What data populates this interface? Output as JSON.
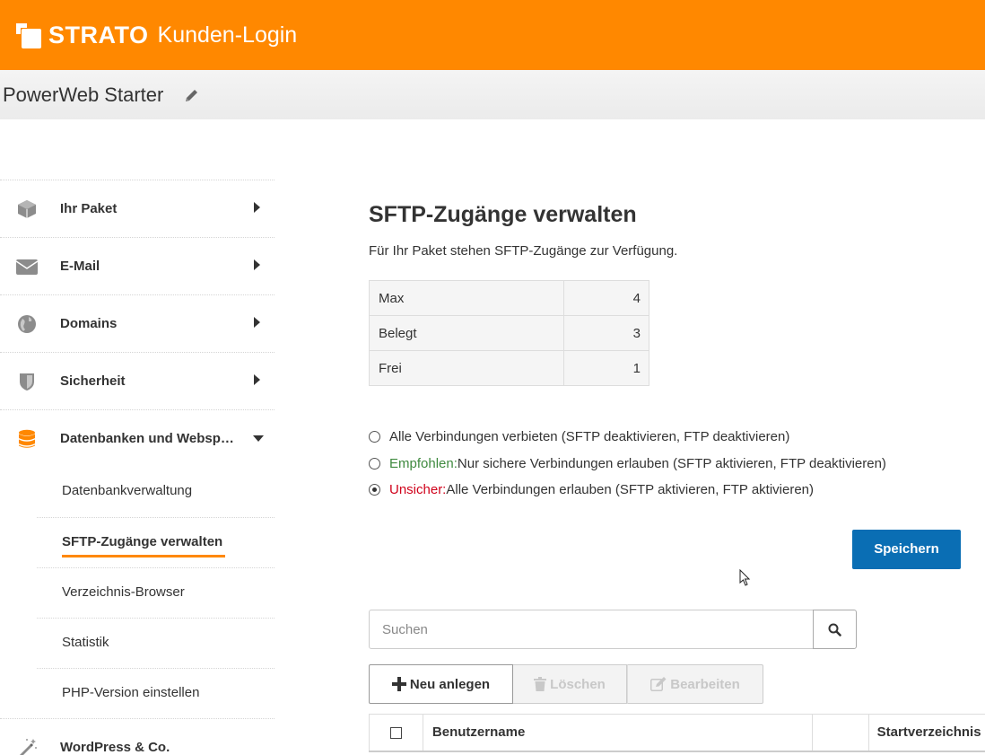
{
  "header": {
    "brand": "STRATO",
    "title": "Kunden-Login",
    "package_name": "PowerWeb Starter"
  },
  "sidebar": {
    "items": [
      {
        "label": "Ihr Paket",
        "icon": "box-icon"
      },
      {
        "label": "E-Mail",
        "icon": "envelope-icon"
      },
      {
        "label": "Domains",
        "icon": "globe-icon"
      },
      {
        "label": "Sicherheit",
        "icon": "shield-icon"
      },
      {
        "label": "Datenbanken und Websp…",
        "icon": "database-icon",
        "expanded": true
      },
      {
        "label": "WordPress & Co.",
        "icon": "magic-wand-icon"
      }
    ],
    "subitems": [
      {
        "label": "Datenbankverwaltung"
      },
      {
        "label": "SFTP-Zugänge verwalten",
        "active": true
      },
      {
        "label": "Verzeichnis-Browser"
      },
      {
        "label": "Statistik"
      },
      {
        "label": "PHP-Version einstellen"
      }
    ]
  },
  "main": {
    "title": "SFTP-Zugänge verwalten",
    "description": "Für Ihr Paket stehen SFTP-Zugänge zur Verfügung.",
    "quota": [
      {
        "key": "Max",
        "value": "4"
      },
      {
        "key": "Belegt",
        "value": "3"
      },
      {
        "key": "Frei",
        "value": "1"
      }
    ],
    "radios": [
      {
        "prefix": "",
        "text": "Alle Verbindungen verbieten (SFTP deaktivieren, FTP deaktivieren)",
        "selected": false
      },
      {
        "prefix": "Empfohlen:",
        "text": " Nur sichere Verbindungen erlauben (SFTP aktivieren, FTP deaktivieren)",
        "selected": false
      },
      {
        "prefix": "Unsicher:",
        "text": " Alle Verbindungen erlauben (SFTP aktivieren, FTP aktivieren)",
        "selected": true
      }
    ],
    "save_label": "Speichern",
    "search_placeholder": "Suchen",
    "toolbar": {
      "new_label": "Neu anlegen",
      "delete_label": "Löschen",
      "edit_label": "Bearbeiten"
    },
    "table": {
      "columns": [
        "",
        "Benutzername",
        "",
        "Startverzeichnis"
      ]
    }
  },
  "colors": {
    "brand_orange": "#ff8800",
    "primary_blue": "#0a6eb4",
    "recommended_green": "#3f8a3f",
    "unsafe_red": "#d0021b"
  }
}
